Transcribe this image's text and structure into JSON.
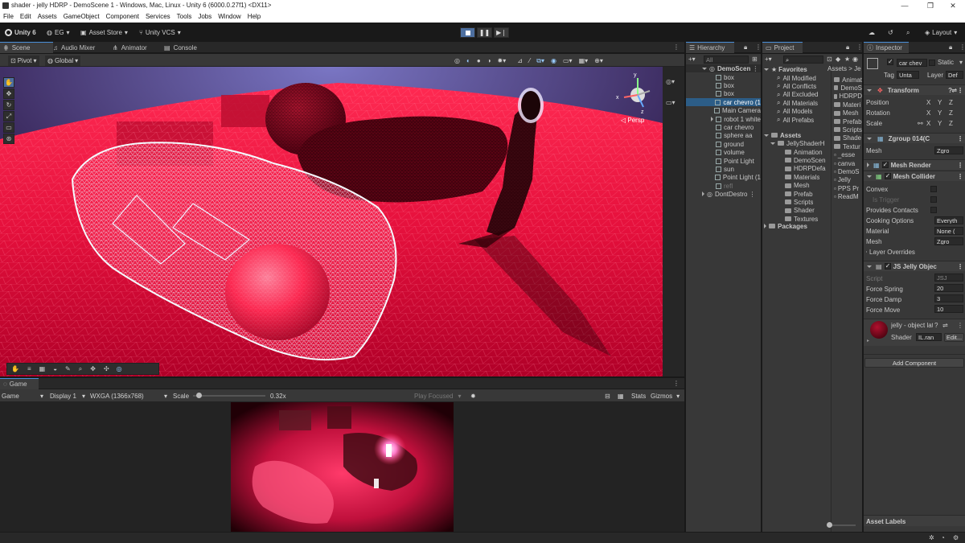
{
  "window": {
    "title": "shader - jelly HDRP - DemoScene 1 - Windows, Mac, Linux - Unity 6 (6000.0.27f1) <DX11>",
    "controls": [
      "—",
      "❐",
      "✕"
    ]
  },
  "menu": [
    "File",
    "Edit",
    "Assets",
    "GameObject",
    "Component",
    "Services",
    "Tools",
    "Jobs",
    "Window",
    "Help"
  ],
  "toolbar": {
    "unity_label": "Unity 6",
    "account_label": "EG",
    "asset_store_label": "Asset Store",
    "vcs_label": "Unity VCS",
    "layout_label": "Layout"
  },
  "scene_tabs": [
    "Scene",
    "Audio Mixer",
    "Animator",
    "Console"
  ],
  "scene_toolbar": {
    "pivot_label": "Pivot",
    "global_label": "Global",
    "persp_label": "Persp",
    "gizmo_axes": {
      "x": "x",
      "y": "y",
      "z": "z"
    }
  },
  "game": {
    "tab_label": "Game",
    "mode_label": "Game",
    "display_label": "Display 1",
    "resolution_label": "WXGA (1366x768)",
    "scale_label": "Scale",
    "scale_value": "0.32x",
    "scale_level": 0.08,
    "play_focused_label": "Play Focused",
    "stats_label": "Stats",
    "gizmos_label": "Gizmos"
  },
  "hierarchy": {
    "tab_label": "Hierarchy",
    "search_placeholder": "All",
    "scene_name": "DemoScen",
    "items": [
      {
        "label": "box",
        "state": "normal"
      },
      {
        "label": "box",
        "state": "normal"
      },
      {
        "label": "box",
        "state": "normal"
      },
      {
        "label": "car chevro (1",
        "state": "selected"
      },
      {
        "label": "Main Camera",
        "state": "normal"
      },
      {
        "label": "robot 1 white",
        "state": "normal"
      },
      {
        "label": "car chevro",
        "state": "normal"
      },
      {
        "label": "sphere aa",
        "state": "normal"
      },
      {
        "label": "ground",
        "state": "normal"
      },
      {
        "label": "volume",
        "state": "normal"
      },
      {
        "label": "Point Light",
        "state": "normal"
      },
      {
        "label": "sun",
        "state": "normal"
      },
      {
        "label": "Point Light (1",
        "state": "normal"
      },
      {
        "label": "refl",
        "state": "dim"
      }
    ],
    "dont_destroy": "DontDestro"
  },
  "project": {
    "tab_label": "Project",
    "favorites_label": "Favorites",
    "favorites": [
      "All Modified",
      "All Conflicts",
      "All Excluded",
      "All Materials",
      "All Models",
      "All Prefabs"
    ],
    "assets_label": "Assets",
    "root_folder": "JellyShaderH",
    "subfolders": [
      "Animation",
      "DemoScen",
      "HDRPDefa",
      "Materials",
      "Mesh",
      "Prefab",
      "Scripts",
      "Shader",
      "Textures"
    ],
    "packages_label": "Packages",
    "breadcrumb": "Assets > Je",
    "right_list": [
      "Animat",
      "DemoS",
      "HDRPD",
      "Materi",
      "Mesh",
      "Prefab",
      "Scripts",
      "Shade",
      "Textur",
      "_esse",
      "canva",
      "DemoS",
      "Jelly",
      "PPS Pr",
      "ReadM"
    ]
  },
  "inspector": {
    "tab_label": "Inspector",
    "object_name": "car chev",
    "static_label": "Static",
    "tag_label": "Tag",
    "tag_value": "Unta",
    "layer_label": "Layer",
    "layer_value": "Def",
    "transform": {
      "title": "Transform",
      "position_label": "Position",
      "rotation_label": "Rotation",
      "scale_label": "Scale",
      "axes": [
        "X",
        "Y",
        "Z"
      ]
    },
    "mesh_filter": {
      "title": "Zgroup 014(C",
      "mesh_label": "Mesh",
      "mesh_value": "Zgro"
    },
    "mesh_renderer": {
      "title": "Mesh Render"
    },
    "mesh_collider": {
      "title": "Mesh Collider",
      "convex_label": "Convex",
      "trigger_label": "Is Trigger",
      "contacts_label": "Provides Contacts",
      "cooking_label": "Cooking Options",
      "cooking_value": "Everyth",
      "material_label": "Material",
      "material_value": "None (",
      "mesh_label": "Mesh",
      "mesh_value": "Zgro",
      "overrides_label": "Layer Overrides"
    },
    "jelly": {
      "title": "JS Jelly Objec",
      "script_label": "Script",
      "script_value": "JSJ",
      "spring_label": "Force Spring",
      "spring_value": "20",
      "damp_label": "Force Damp",
      "damp_value": "3",
      "move_label": "Force Move",
      "move_value": "10"
    },
    "material": {
      "name": "jelly - object lat",
      "shader_label": "Shader",
      "shader_value": "IL.ran",
      "edit_label": "Edit..."
    },
    "add_component_label": "Add Component",
    "asset_labels_label": "Asset Labels"
  },
  "colors": {
    "accent": "#4b8fd9",
    "selection": "#2c5d87",
    "scene_red": "#d9103a",
    "panel": "#383838"
  }
}
